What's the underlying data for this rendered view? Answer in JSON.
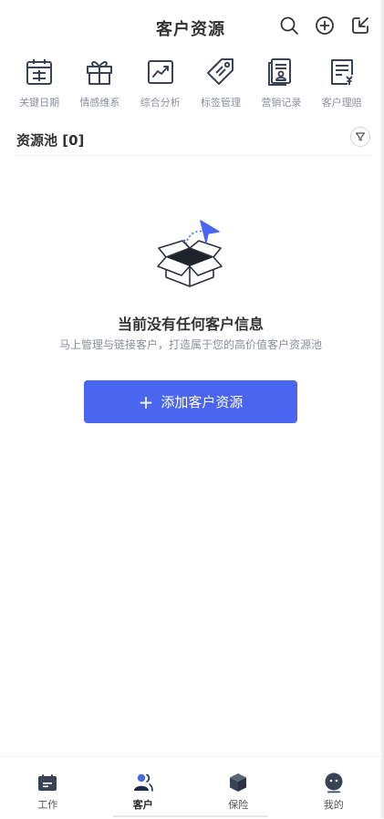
{
  "header": {
    "title": "客户资源"
  },
  "header_icons": [
    "search-icon",
    "add-circle-icon",
    "import-icon"
  ],
  "features": [
    {
      "label": "关键日期",
      "icon": "calendar-icon"
    },
    {
      "label": "情感维系",
      "icon": "gift-icon"
    },
    {
      "label": "综合分析",
      "icon": "chart-icon"
    },
    {
      "label": "标签管理",
      "icon": "tag-icon"
    },
    {
      "label": "营销记录",
      "icon": "record-icon"
    },
    {
      "label": "客户理赔",
      "icon": "claim-icon"
    }
  ],
  "section": {
    "title": "资源池 [0]"
  },
  "empty_state": {
    "title": "当前没有任何客户信息",
    "subtitle": "马上管理与链接客户，打造属于您的高价值客户资源池",
    "button_label": "添加客户资源"
  },
  "tabs": [
    {
      "label": "工作",
      "icon": "work-icon",
      "active": false
    },
    {
      "label": "客户",
      "icon": "customer-icon",
      "active": true
    },
    {
      "label": "保险",
      "icon": "insurance-icon",
      "active": false
    },
    {
      "label": "我的",
      "icon": "profile-icon",
      "active": false
    }
  ],
  "colors": {
    "accent": "#4a66f0",
    "icon_dark": "#3a4356",
    "label_gray": "#8a8f99"
  }
}
